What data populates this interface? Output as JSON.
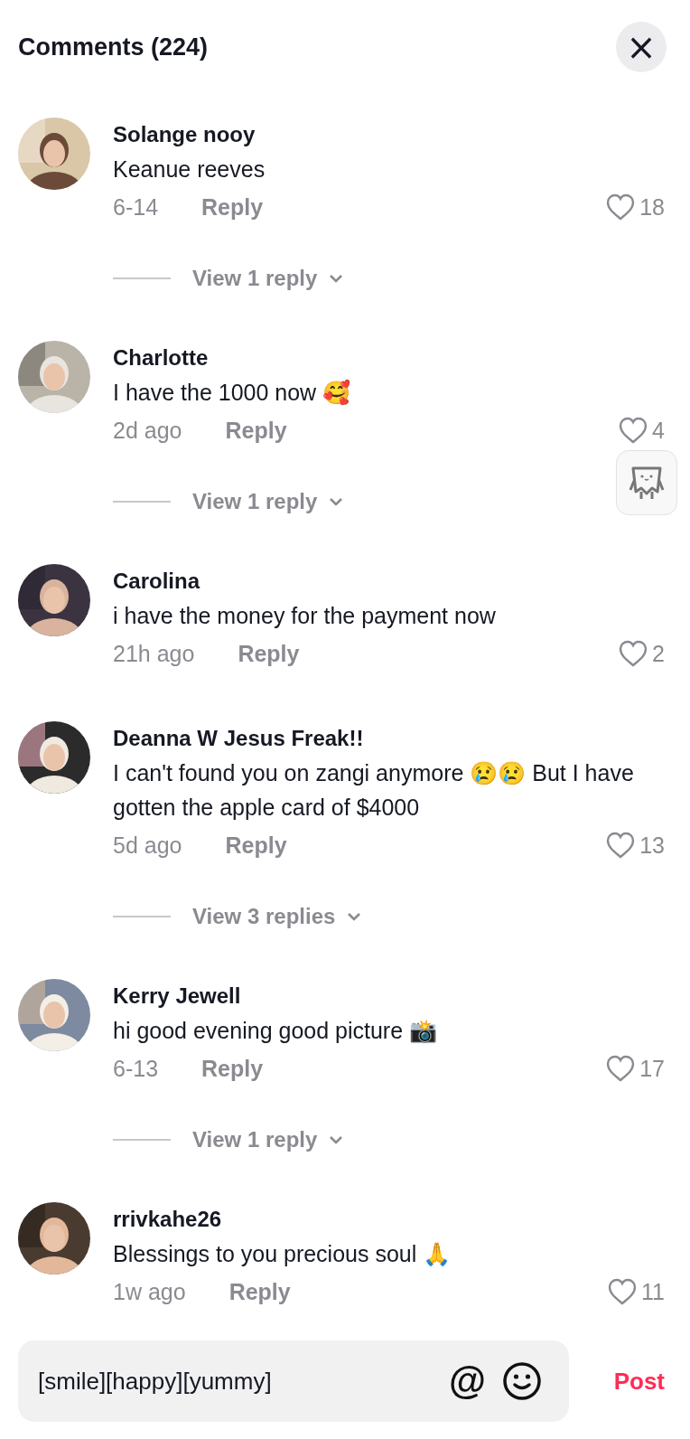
{
  "header": {
    "title": "Comments (224)",
    "close": "×"
  },
  "comments": [
    {
      "author": "Solange nooy",
      "text": "Keanue reeves",
      "time": "6-14",
      "reply": "Reply",
      "likes": "18",
      "replies": "View 1 reply"
    },
    {
      "author": "Charlotte",
      "text": "I have the 1000 now 🥰",
      "time": "2d ago",
      "reply": "Reply",
      "likes": "4",
      "replies": "View 1 reply"
    },
    {
      "author": "Carolina",
      "text": "i have the money for the payment now",
      "time": "21h ago",
      "reply": "Reply",
      "likes": "2"
    },
    {
      "author": "Deanna W Jesus Freak!!",
      "text": "I can't found you on zangi anymore 😢😢 But I have gotten the apple card of $4000",
      "time": "5d ago",
      "reply": "Reply",
      "likes": "13",
      "replies": "View 3 replies"
    },
    {
      "author": "Kerry Jewell",
      "text": "hi good evening good picture 📸",
      "time": "6-13",
      "reply": "Reply",
      "likes": "17",
      "replies": "View 1 reply"
    },
    {
      "author": "rrivkahe26",
      "text": "Blessings to you precious soul 🙏",
      "time": "1w ago",
      "reply": "Reply",
      "likes": "11"
    }
  ],
  "composer": {
    "value": "[smile][happy][yummy]",
    "mention": "@",
    "post": "Post"
  }
}
